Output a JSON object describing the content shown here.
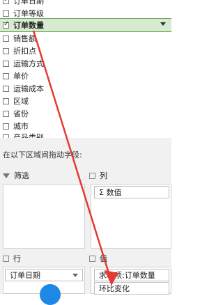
{
  "fields": [
    {
      "label": "订单日期",
      "checked": true
    },
    {
      "label": "订单等级",
      "checked": false
    },
    {
      "label": "订单数量",
      "checked": true,
      "selected": true
    },
    {
      "label": "销售额",
      "checked": false
    },
    {
      "label": "折扣点",
      "checked": false
    },
    {
      "label": "运输方式",
      "checked": false
    },
    {
      "label": "单价",
      "checked": false
    },
    {
      "label": "运输成本",
      "checked": false
    },
    {
      "label": "区域",
      "checked": false
    },
    {
      "label": "省份",
      "checked": false
    },
    {
      "label": "城市",
      "checked": false
    },
    {
      "label": "产品类别",
      "checked": false
    }
  ],
  "drag_hint": "在以下区域间拖动字段:",
  "zones": {
    "filters": {
      "title": "筛选"
    },
    "columns": {
      "title": "列",
      "items": [
        "Σ 数值"
      ]
    },
    "rows": {
      "title": "行",
      "items": [
        "订单日期"
      ]
    },
    "values": {
      "title": "值",
      "items": [
        "求和项:订单数量",
        "环比变化"
      ]
    }
  },
  "colors": {
    "highlight_bg": "#d9ead3",
    "arrow": "#e53935"
  }
}
